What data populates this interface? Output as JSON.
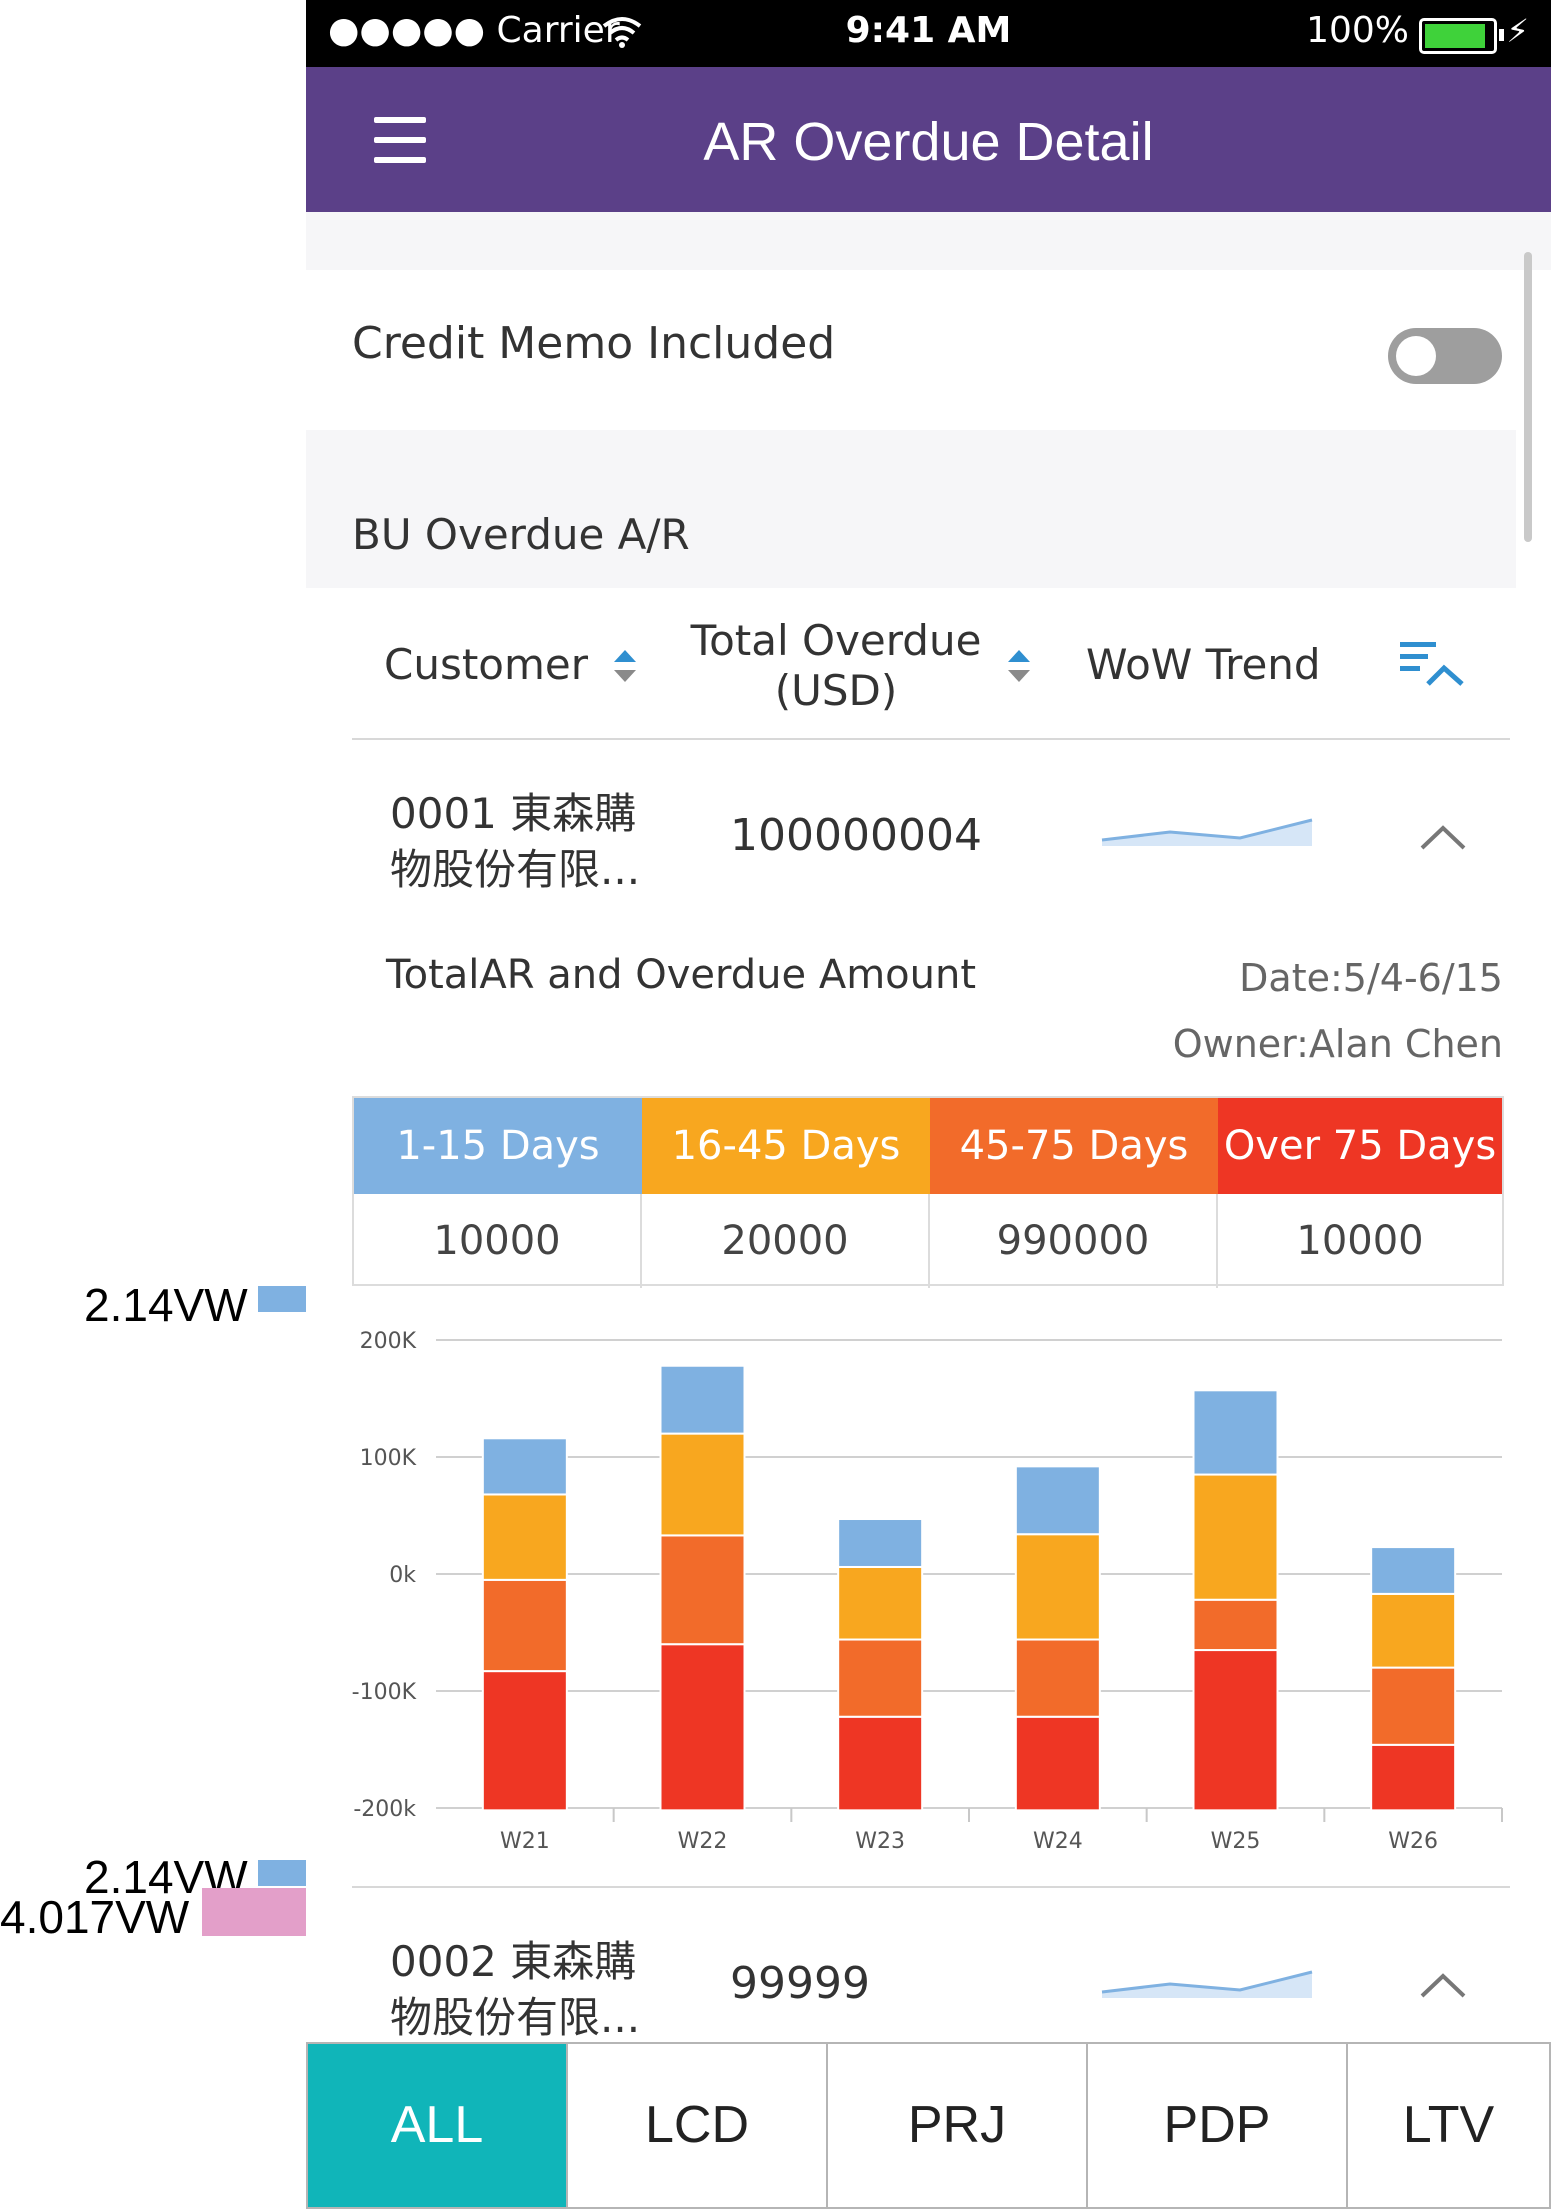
{
  "status_bar": {
    "carrier": "●●●●● Carrier",
    "time": "9:41 AM",
    "battery": "100%"
  },
  "header": {
    "title": "AR Overdue Detail"
  },
  "settings": {
    "credit_memo_label": "Credit Memo Included",
    "credit_memo_on": false
  },
  "section": {
    "title": "BU Overdue A/R"
  },
  "table_header": {
    "customer": "Customer",
    "total_overdue_line1": "Total Overdue",
    "total_overdue_line2": "(USD)",
    "wow_trend": "WoW Trend"
  },
  "rows": [
    {
      "customer_line1": "0001 東森購",
      "customer_line2": "物股份有限...",
      "total": "100000004",
      "trend": [
        2,
        3,
        2,
        5
      ]
    },
    {
      "customer_line1": "0002 東森購",
      "customer_line2": "物股份有限...",
      "total": "99999",
      "trend": [
        2,
        3,
        2,
        5
      ]
    }
  ],
  "detail": {
    "title": "TotalAR and Overdue Amount",
    "date": "Date:5/4-6/15",
    "owner": "Owner:Alan Chen",
    "buckets": [
      {
        "label": "1-15 Days",
        "value": "10000",
        "color": "#7fb1e1"
      },
      {
        "label": "16-45 Days",
        "value": "20000",
        "color": "#f8a71f"
      },
      {
        "label": "45-75 Days",
        "value": "990000",
        "color": "#f26b2a"
      },
      {
        "label": "Over 75 Days",
        "value": "10000",
        "color": "#ee3624"
      }
    ]
  },
  "chart_data": {
    "type": "bar",
    "stacked": true,
    "categories": [
      "W21",
      "W22",
      "W23",
      "W24",
      "W25",
      "W26"
    ],
    "y_tick_labels": [
      "200K",
      "100K",
      "0k",
      "-100K",
      "-200k"
    ],
    "y_ticks": [
      200000,
      100000,
      0,
      -100000,
      -200000
    ],
    "ylim": [
      -200000,
      200000
    ],
    "series": [
      {
        "color": "#ee3624",
        "values": [
          -202000,
          -202000,
          -202000,
          -202000,
          -202000,
          -202000
        ],
        "tops": [
          -83000,
          -60000,
          -122000,
          -122000,
          -65000,
          -146000
        ]
      },
      {
        "color": "#f26b2a",
        "values": [
          0,
          0,
          0,
          0,
          0,
          0
        ],
        "tops": [
          -5000,
          33000,
          -56000,
          -56000,
          -22000,
          -80000
        ]
      },
      {
        "color": "#f8a71f",
        "values": [
          0,
          0,
          0,
          0,
          0,
          0
        ],
        "tops": [
          68000,
          120000,
          6000,
          34000,
          85000,
          -17000
        ]
      },
      {
        "color": "#7fb1e1",
        "values": [
          0,
          0,
          0,
          0,
          0,
          0
        ],
        "tops": [
          116000,
          178000,
          47000,
          92000,
          157000,
          23000
        ]
      }
    ],
    "grid": true
  },
  "tabs": [
    {
      "label": "ALL",
      "active": true
    },
    {
      "label": "LCD",
      "active": false
    },
    {
      "label": "PRJ",
      "active": false
    },
    {
      "label": "PDP",
      "active": false
    },
    {
      "label": "LTV",
      "active": false
    }
  ],
  "annotations": [
    {
      "label": "2.14VW",
      "color": "#7fb1e1"
    },
    {
      "label": "2.14VW",
      "color": "#7fb1e1"
    },
    {
      "label": "4.017VW",
      "color": "#e39fc9"
    }
  ]
}
